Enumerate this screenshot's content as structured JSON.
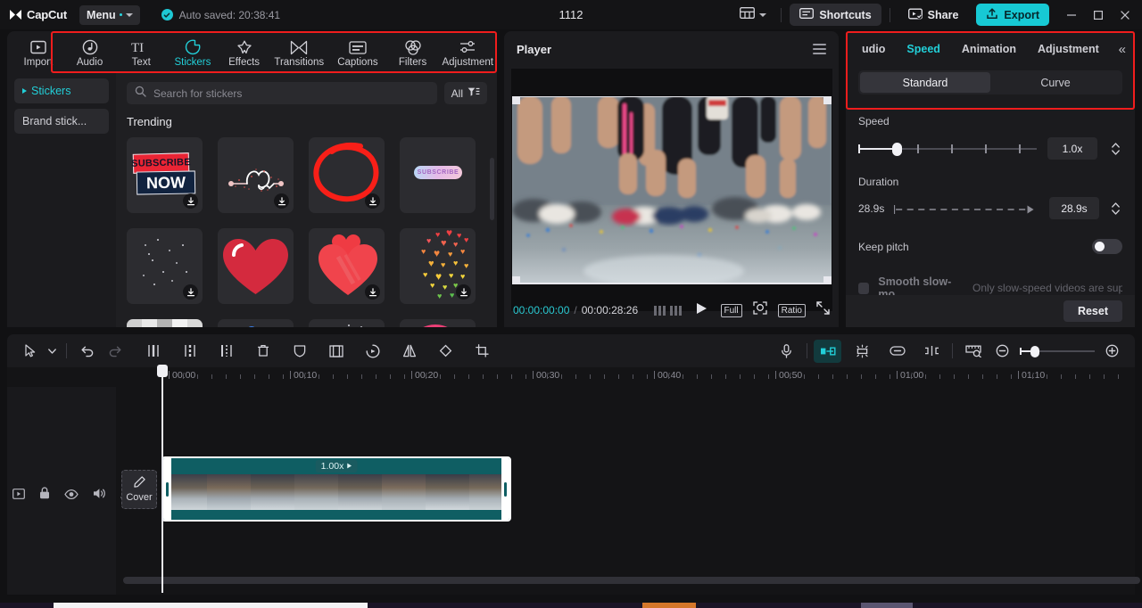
{
  "titlebar": {
    "app_name": "CapCut",
    "menu_label": "Menu",
    "autosave": "Auto saved: 20:38:41",
    "project_title": "1112",
    "layout_icon": "layout-icon",
    "shortcuts_label": "Shortcuts",
    "share_label": "Share",
    "export_label": "Export",
    "minimize_icon": "minimize-icon",
    "maximize_icon": "maximize-icon",
    "close_icon": "close-icon",
    "accent": "#17c9d4"
  },
  "toolbar": {
    "highlight_color": "#f01d1d",
    "items": [
      {
        "label": "Import",
        "icon": "import-icon",
        "active": false
      },
      {
        "label": "Audio",
        "icon": "audio-note-icon",
        "active": false
      },
      {
        "label": "Text",
        "icon": "text-ti-icon",
        "active": false
      },
      {
        "label": "Stickers",
        "icon": "sticker-icon",
        "active": true
      },
      {
        "label": "Effects",
        "icon": "effects-star-icon",
        "active": false
      },
      {
        "label": "Transitions",
        "icon": "transitions-icon",
        "active": false
      },
      {
        "label": "Captions",
        "icon": "captions-icon",
        "active": false
      },
      {
        "label": "Filters",
        "icon": "filters-circles-icon",
        "active": false
      },
      {
        "label": "Adjustment",
        "icon": "adjustment-sliders-icon",
        "active": false
      }
    ]
  },
  "left_nav": {
    "items": [
      {
        "label": "Stickers",
        "active": true
      },
      {
        "label": "Brand stick...",
        "active": false
      }
    ]
  },
  "library": {
    "search_placeholder": "Search for stickers",
    "search_icon": "search-icon",
    "filter_label": "All",
    "filter_icon": "filter-icon",
    "section_title": "Trending",
    "stickers": [
      {
        "name": "subscribe-now-banner",
        "download": true
      },
      {
        "name": "heart-arrow-sparkle",
        "download": true
      },
      {
        "name": "red-circle-scribble",
        "download": true
      },
      {
        "name": "subscribe-gradient-pill",
        "download": false
      },
      {
        "name": "sparkle-dust",
        "download": true
      },
      {
        "name": "red-heart-glossy",
        "download": false
      },
      {
        "name": "double-heart",
        "download": true
      },
      {
        "name": "rainbow-heart-shower",
        "download": true
      },
      {
        "name": "checkerboard-transition",
        "download": false
      },
      {
        "name": "blue-neon-scribble",
        "download": false
      },
      {
        "name": "white-particles",
        "download": false
      },
      {
        "name": "pink-blob",
        "download": false
      }
    ]
  },
  "player": {
    "title": "Player",
    "menu_icon": "hamburger-icon",
    "current_time": "00:00:00:00",
    "separator": "/",
    "total_time": "00:00:28:26",
    "play_icon": "play-icon",
    "frames_icon": "frames-icon",
    "full_label": "Full",
    "zoom_icon": "focus-zoom-icon",
    "ratio_label": "Ratio",
    "fullscreen_icon": "fullscreen-icon"
  },
  "right_panel": {
    "highlight_color": "#f01d1d",
    "tabs": [
      {
        "label": "udio",
        "active": false
      },
      {
        "label": "Speed",
        "active": true
      },
      {
        "label": "Animation",
        "active": false
      },
      {
        "label": "Adjustment",
        "active": false
      }
    ],
    "collapse_icon": "chevron-double-left-icon",
    "segments": [
      {
        "label": "Standard",
        "active": true
      },
      {
        "label": "Curve",
        "active": false
      }
    ],
    "speed_label": "Speed",
    "speed_value": "1.0x",
    "speed_slider_percent": 19,
    "duration_label": "Duration",
    "duration_left": "28.9s",
    "duration_value": "28.9s",
    "keep_pitch_label": "Keep pitch",
    "keep_pitch_on": false,
    "smooth_label": "Smooth slow-mo",
    "smooth_hint": "Only slow-speed videos are supp",
    "reset_label": "Reset"
  },
  "timeline": {
    "tools_left": [
      {
        "name": "select-arrow-icon"
      },
      {
        "name": "chevron-down-icon"
      },
      {
        "name": "undo-icon"
      },
      {
        "name": "redo-icon"
      },
      {
        "name": "split-icon"
      },
      {
        "name": "trim-left-icon"
      },
      {
        "name": "trim-right-icon"
      },
      {
        "name": "delete-icon"
      },
      {
        "name": "mask-icon"
      },
      {
        "name": "crop-frame-icon"
      },
      {
        "name": "reverse-icon"
      },
      {
        "name": "mirror-icon"
      },
      {
        "name": "rotate-icon"
      },
      {
        "name": "crop-icon"
      }
    ],
    "tools_right": [
      {
        "name": "microphone-icon",
        "active": false
      },
      {
        "name": "magnet-snap-icon",
        "active": true
      },
      {
        "name": "auto-adjust-icon",
        "active": false
      },
      {
        "name": "link-icon",
        "active": false
      },
      {
        "name": "keyframe-icon",
        "active": false
      },
      {
        "name": "timeline-preview-icon",
        "active": false
      },
      {
        "name": "zoom-out-icon",
        "active": false
      },
      {
        "name": "zoom-in-icon",
        "active": false
      }
    ],
    "ruler_labels": [
      "00:00",
      "00:10",
      "00:20",
      "00:30",
      "00:40",
      "00:50",
      "01:00",
      "01:10"
    ],
    "track_icons": [
      "track-type-icon",
      "lock-icon",
      "eye-icon",
      "volume-icon",
      "more-icon"
    ],
    "cover_label": "Cover",
    "cover_icon": "pencil-icon",
    "clip_speed_badge": "1.00x",
    "clip_badge_icon": "play-small-icon",
    "playhead_time": "00:00"
  }
}
